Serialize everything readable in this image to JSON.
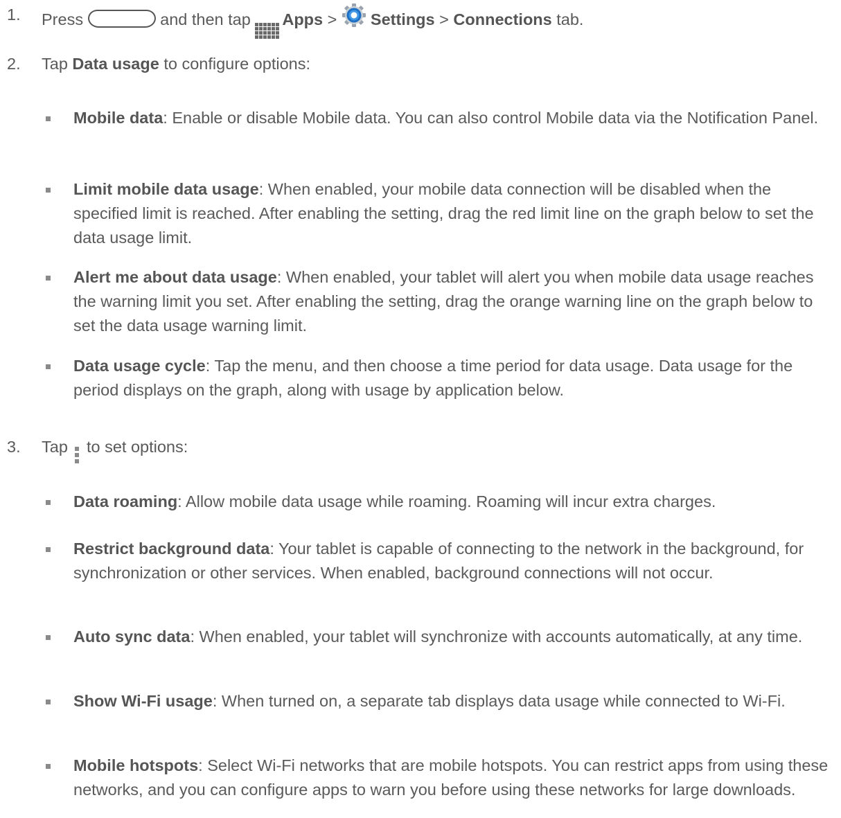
{
  "step1": {
    "num": "1.",
    "press": "Press",
    "and_then_tap": "and then tap",
    "apps": "Apps",
    "sep1": ">",
    "settings": "Settings",
    "sep2": ">",
    "connections": "Connections",
    "tab": "tab.",
    "icons": [
      "home-key-icon",
      "apps-grid-icon",
      "settings-gear-icon"
    ]
  },
  "step2": {
    "num": "2.",
    "tap": "Tap",
    "data_usage": "Data usage",
    "rest": "to configure options:",
    "items": [
      {
        "term": "Mobile data",
        "desc": ": Enable or disable Mobile data. You can also control Mobile data via the Notification Panel."
      },
      {
        "term": "Limit mobile data usage",
        "desc": ": When enabled, your mobile data connection will be disabled when the specified limit is reached. After enabling the setting, drag the red limit line on the graph below to set the data usage limit."
      },
      {
        "term": "Alert me about data usage",
        "desc": ": When enabled, your tablet will alert you when mobile data usage reaches the warning limit you set. After enabling the setting, drag the orange warning line on the graph below to set the data usage warning limit."
      },
      {
        "term": "Data usage cycle",
        "desc": ": Tap the menu, and then choose a time period for data usage. Data usage for the period displays on the graph, along with usage by application below."
      }
    ]
  },
  "step3": {
    "num": "3.",
    "tap": "Tap",
    "rest": "to set options:",
    "icon": "menu-icon",
    "items": [
      {
        "term": "Data roaming",
        "desc": ": Allow mobile data usage while roaming. Roaming will incur extra charges."
      },
      {
        "term": "Restrict background data",
        "desc": ": Your tablet is capable of connecting to the network in the background, for synchronization or other services. When enabled, background connections will not occur."
      },
      {
        "term": "Auto sync data",
        "desc": ": When enabled, your tablet will synchronize with accounts automatically, at any time."
      },
      {
        "term": "Show Wi-Fi usage",
        "desc": ": When turned on, a separate tab displays data usage while connected to Wi-Fi."
      },
      {
        "term": "Mobile hotspots",
        "desc": ": Select Wi-Fi networks that are mobile hotspots. You can restrict apps from using these networks, and you can configure apps to warn you before using these networks for large downloads."
      }
    ]
  }
}
